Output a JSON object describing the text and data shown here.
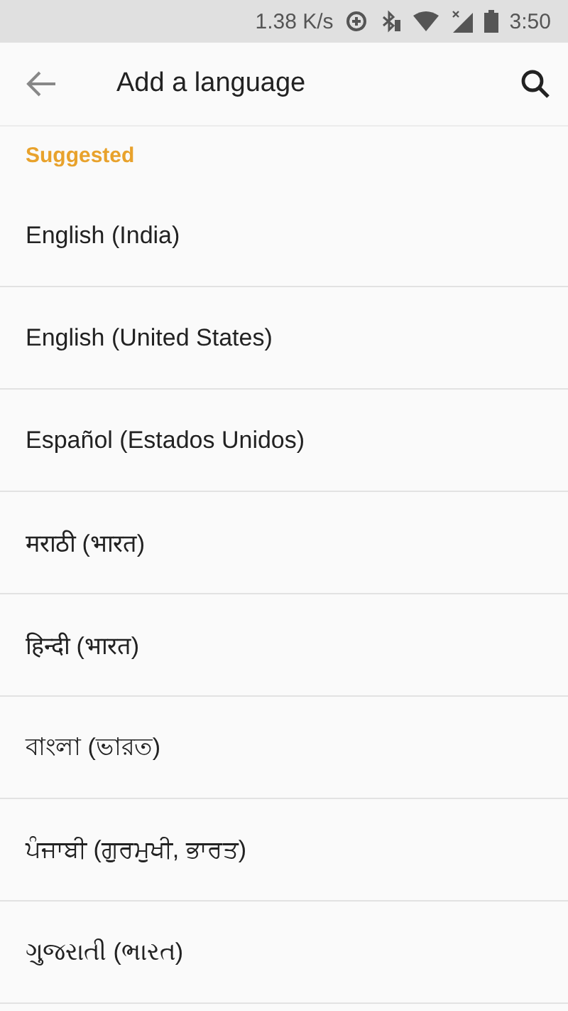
{
  "status_bar": {
    "speed": "1.38 K/s",
    "time": "3:50"
  },
  "app_bar": {
    "title": "Add a language"
  },
  "section": {
    "header": "Suggested"
  },
  "languages": [
    {
      "label": "English (India)"
    },
    {
      "label": "English (United States)"
    },
    {
      "label": "Español (Estados Unidos)"
    },
    {
      "label": "मराठी (भारत)"
    },
    {
      "label": "हिन्दी (भारत)"
    },
    {
      "label": "বাংলা (ভারত)"
    },
    {
      "label": "ਪੰਜਾਬੀ (ਗੁਰਮੁਖੀ, ਭਾਰਤ)"
    },
    {
      "label": "ગુજરાતી (ભારત)"
    }
  ]
}
